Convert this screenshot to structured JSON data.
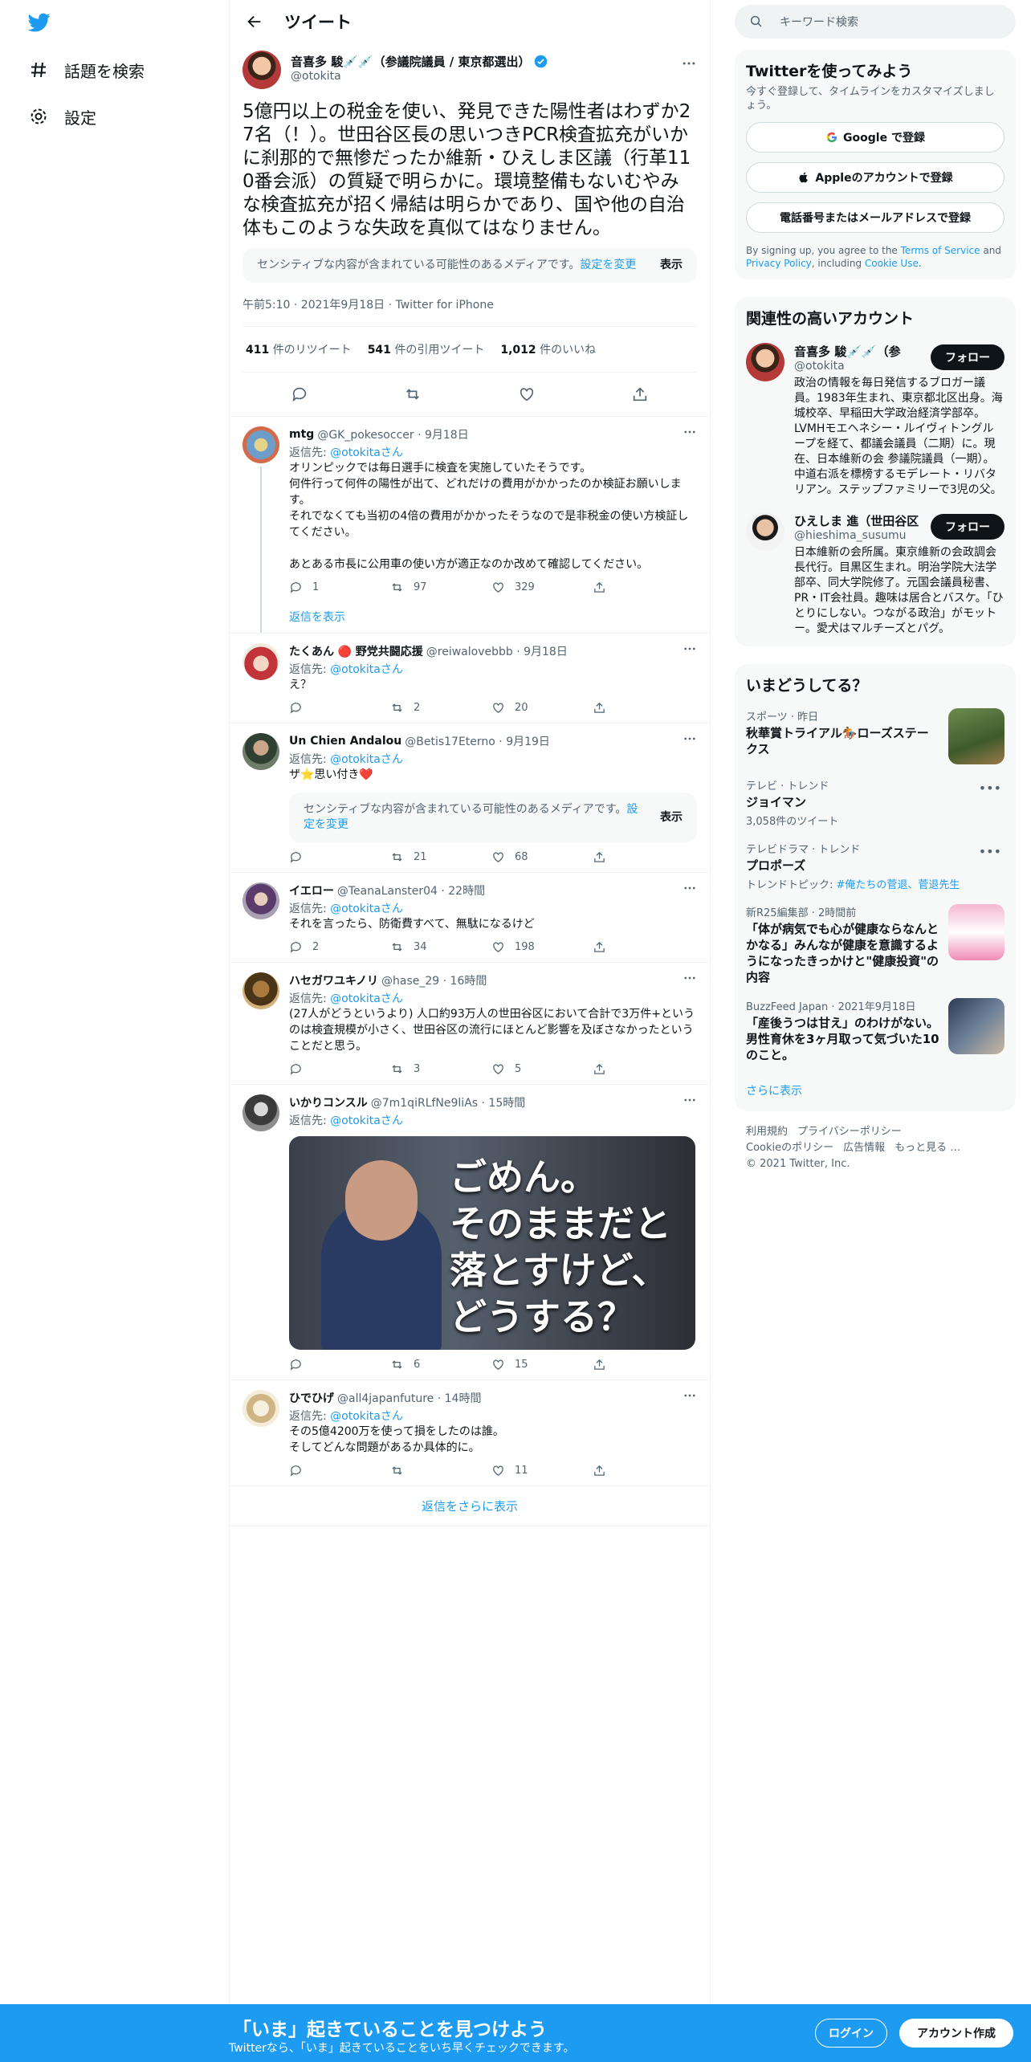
{
  "nav": {
    "explore_label": "話題を検索",
    "settings_label": "設定"
  },
  "header": {
    "title": "ツイート"
  },
  "main_tweet": {
    "name": "音喜多 駿💉💉（参議院議員 / 東京都選出）",
    "handle": "@otokita",
    "text": "5億円以上の税金を使い、発見できた陽性者はわずか27名（！）。世田谷区長の思いつきPCR検査拡充がいかに刹那的で無惨だったか維新・ひえしま区議（行革110番会派）の質疑で明らかに。環境整備もないむやみな検査拡充が招く帰結は明らかであり、国や他の自治体もこのような失政を真似てはなりません。",
    "sensitive_text": "センシティブな内容が含まれている可能性のあるメディアです。",
    "sensitive_link": "設定を変更",
    "show_label": "表示",
    "meta": "午前5:10 · 2021年9月18日 · Twitter for iPhone",
    "retweets_count": "411",
    "retweets_label": "件のリツイート",
    "quotes_count": "541",
    "quotes_label": "件の引用ツイート",
    "likes_count": "1,012",
    "likes_label": "件のいいね"
  },
  "replies": [
    {
      "name": "mtg",
      "handle": "@GK_pokesoccer · 9月18日",
      "replyto_prefix": "返信先: ",
      "replyto_user": "@otokitaさん",
      "text": "オリンピックでは毎日選手に検査を実施していたそうです。\n何件行って何件の陽性が出て、どれだけの費用がかかったのか検証お願いします。\nそれでなくても当初の4倍の費用がかかったそうなので是非税金の使い方検証してください。\n\nあとある市長に公用車の使い方が適正なのか改めて確認してください。",
      "replies": "1",
      "retweets": "97",
      "likes": "329",
      "show_replies": "返信を表示"
    },
    {
      "name": "たくあん",
      "name_suffix": "🔴 野党共闘応援",
      "handle": "@reiwalovebbb · 9月18日",
      "replyto_prefix": "返信先: ",
      "replyto_user": "@otokitaさん",
      "text": "え？",
      "replies": "",
      "retweets": "2",
      "likes": "20"
    },
    {
      "name": "Un Chien Andalou",
      "handle": "@Betis17Eterno · 9月19日",
      "replyto_prefix": "返信先: ",
      "replyto_user": "@otokitaさん",
      "text": "ザ⭐️思い付き❤️",
      "sensitive_text": "センシティブな内容が含まれている可能性のあるメディアです。",
      "sensitive_link": "設定を変更",
      "show_label": "表示",
      "replies": "",
      "retweets": "21",
      "likes": "68"
    },
    {
      "name": "イエロー",
      "handle": "@TeanaLanster04 · 22時間",
      "replyto_prefix": "返信先: ",
      "replyto_user": "@otokitaさん",
      "text": "それを言ったら、防衛費すべて、無駄になるけど",
      "replies": "2",
      "retweets": "34",
      "likes": "198"
    },
    {
      "name": "ハセガワユキノリ",
      "handle": "@hase_29 · 16時間",
      "replyto_prefix": "返信先: ",
      "replyto_user": "@otokitaさん",
      "text": "(27人がどうというより) 人口約93万人の世田谷区において合計で3万件+というのは検査規模が小さく、世田谷区の流行にほとんど影響を及ぼさなかったということだと思う。",
      "replies": "",
      "retweets": "3",
      "likes": "5"
    },
    {
      "name": "いかりコンスル",
      "handle": "@7m1qiRLfNe9liAs · 15時間",
      "replyto_prefix": "返信先: ",
      "replyto_user": "@otokitaさん",
      "image_caption": "ごめん。\nそのままだと\n落とすけど、\nどうする？",
      "replies": "",
      "retweets": "6",
      "likes": "15"
    },
    {
      "name": "ひでひげ",
      "handle": "@all4japanfuture · 14時間",
      "replyto_prefix": "返信先: ",
      "replyto_user": "@otokitaさん",
      "text": "その5億4200万を使って損をしたのは誰。\nそしてどんな問題があるか具体的に。",
      "replies": "",
      "retweets": "",
      "likes": "11"
    }
  ],
  "more_replies": "返信をさらに表示",
  "right": {
    "search_placeholder": "キーワード検索",
    "signup_title": "Twitterを使ってみよう",
    "signup_sub": "今すぐ登録して、タイムラインをカスタマイズしましょう。",
    "google_btn": "Google で登録",
    "apple_btn": "Appleのアカウントで登録",
    "phone_btn": "電話番号またはメールアドレスで登録",
    "terms_pre": "By signing up, you agree to the ",
    "terms_link1": "Terms of Service",
    "terms_mid": " and ",
    "terms_link2": "Privacy Policy",
    "terms_post": ", including ",
    "terms_link3": "Cookie Use",
    "terms_end": ".",
    "related_title": "関連性の高いアカウント",
    "accounts": [
      {
        "name": "音喜多 駿💉💉（参",
        "handle": "@otokita",
        "follow": "フォロー",
        "bio": "政治の情報を毎日発信するブロガー議員。1983年生まれ、東京都北区出身。海城校卒、早稲田大学政治経済学部卒。LVMHモエヘネシー・ルイヴィトングループを経て、都議会議員（二期）に。現在、日本維新の会 参議院議員（一期）。中道右派を標榜するモデレート・リバタリアン。ステップファミリーで3児の父。"
      },
      {
        "name": "ひえしま 進（世田谷区",
        "handle": "@hieshima_susumu",
        "follow": "フォロー",
        "bio": "日本維新の会所属。東京維新の会政調会長代行。目黒区生まれ。明治学院大法学部卒、同大学院修了。元国会議員秘書、PR・IT会社員。趣味は居合とバスケ。「ひとりにしない。つながる政治」がモットー。愛犬はマルチーズとパグ。"
      }
    ],
    "trends_title": "いまどうしてる？",
    "trends": [
      {
        "cat": "スポーツ · 昨日",
        "title": "秋華賞トライアル🏇ローズステークス",
        "sub": ""
      },
      {
        "cat": "テレビ · トレンド",
        "title": "ジョイマン",
        "sub": "3,058件のツイート"
      },
      {
        "cat": "テレビドラマ · トレンド",
        "title": "プロポーズ",
        "sub_pre": "トレンドトピック: ",
        "sub_links": "#俺たちの菅退、菅退先生"
      },
      {
        "cat": "新R25編集部 · 2時間前",
        "title": "「体が病気でも心が健康ならなんとかなる」みんなが健康を意識するようになったきっかけと\"健康投資\"の内容",
        "sub": ""
      },
      {
        "cat": "BuzzFeed Japan · 2021年9月18日",
        "title": "「産後うつは甘え」のわけがない。男性育休を3ヶ月取って気づいた10のこと。",
        "sub": ""
      }
    ],
    "show_more": "さらに表示",
    "footer": [
      "利用規約",
      "プライバシーポリシー",
      "Cookieのポリシー",
      "広告情報",
      "もっと見る …",
      "© 2021 Twitter, Inc."
    ]
  },
  "bottom_bar": {
    "title": "「いま」起きていることを見つけよう",
    "sub": "Twitterなら、「いま」起きていることをいち早くチェックできます。",
    "login": "ログイン",
    "signup": "アカウント作成"
  },
  "colors": {
    "accent": "#1d9bf0",
    "text": "#0f1419",
    "muted": "#536471"
  }
}
